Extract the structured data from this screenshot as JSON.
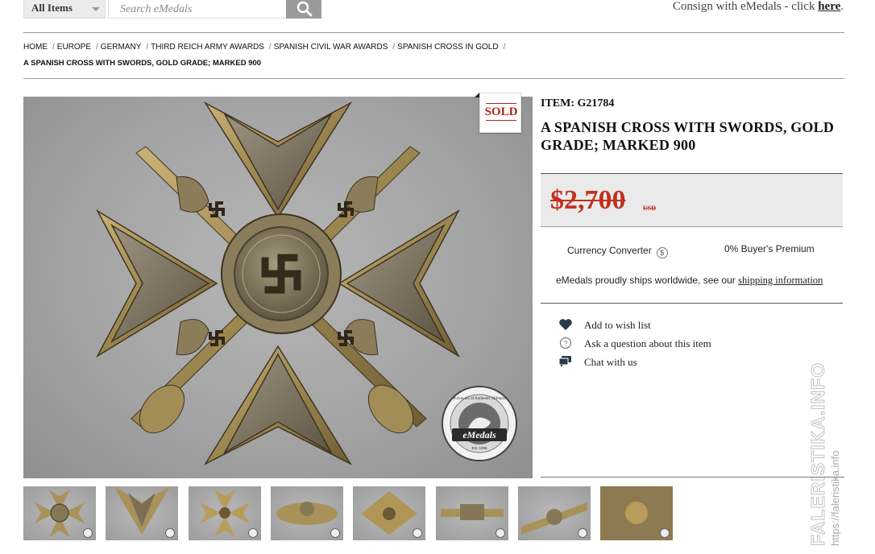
{
  "search": {
    "category": "All Items",
    "placeholder": "Search eMedals"
  },
  "header": {
    "consign_text": "Consign with eMedals - click ",
    "consign_link": "here",
    "consign_end": "."
  },
  "breadcrumb": {
    "items": [
      "HOME",
      "EUROPE",
      "GERMANY",
      "THIRD REICH ARMY AWARDS",
      "SPANISH CIVIL WAR AWARDS",
      "SPANISH CROSS IN GOLD"
    ],
    "separator": "/",
    "current": "A SPANISH CROSS WITH SWORDS, GOLD GRADE; MARKED 900"
  },
  "badge": {
    "label": "SOLD"
  },
  "logo": {
    "name": "eMedals",
    "ring_text": "Purveyors of Authentic Militaria",
    "since": "Est. 1995"
  },
  "product": {
    "item_label": "ITEM: G21784",
    "title": "A SPANISH CROSS WITH SWORDS, GOLD GRADE; MARKED 900",
    "price": "$2,700",
    "currency": "USD",
    "currency_converter": "Currency Converter",
    "currency_icon": "$",
    "buyers_premium": "0% Buyer's Premium",
    "shipping_text": "eMedals proudly ships worldwide, see our ",
    "shipping_link": "shipping information"
  },
  "actions": [
    {
      "icon": "heart-icon",
      "label": "Add to wish list"
    },
    {
      "icon": "question-icon",
      "label": "Ask a question about this item"
    },
    {
      "icon": "chat-icon",
      "label": "Chat with us"
    }
  ],
  "thumbnails": {
    "count": 8
  },
  "watermark": {
    "brand": "FALERISTIKA.INFO",
    "url": "https://faleristika.info"
  },
  "colors": {
    "sold_red": "#c0301f",
    "price_bg": "#eaeaea",
    "photo_bg": "#a4a4a4",
    "medal_gold": "#a8925a"
  }
}
